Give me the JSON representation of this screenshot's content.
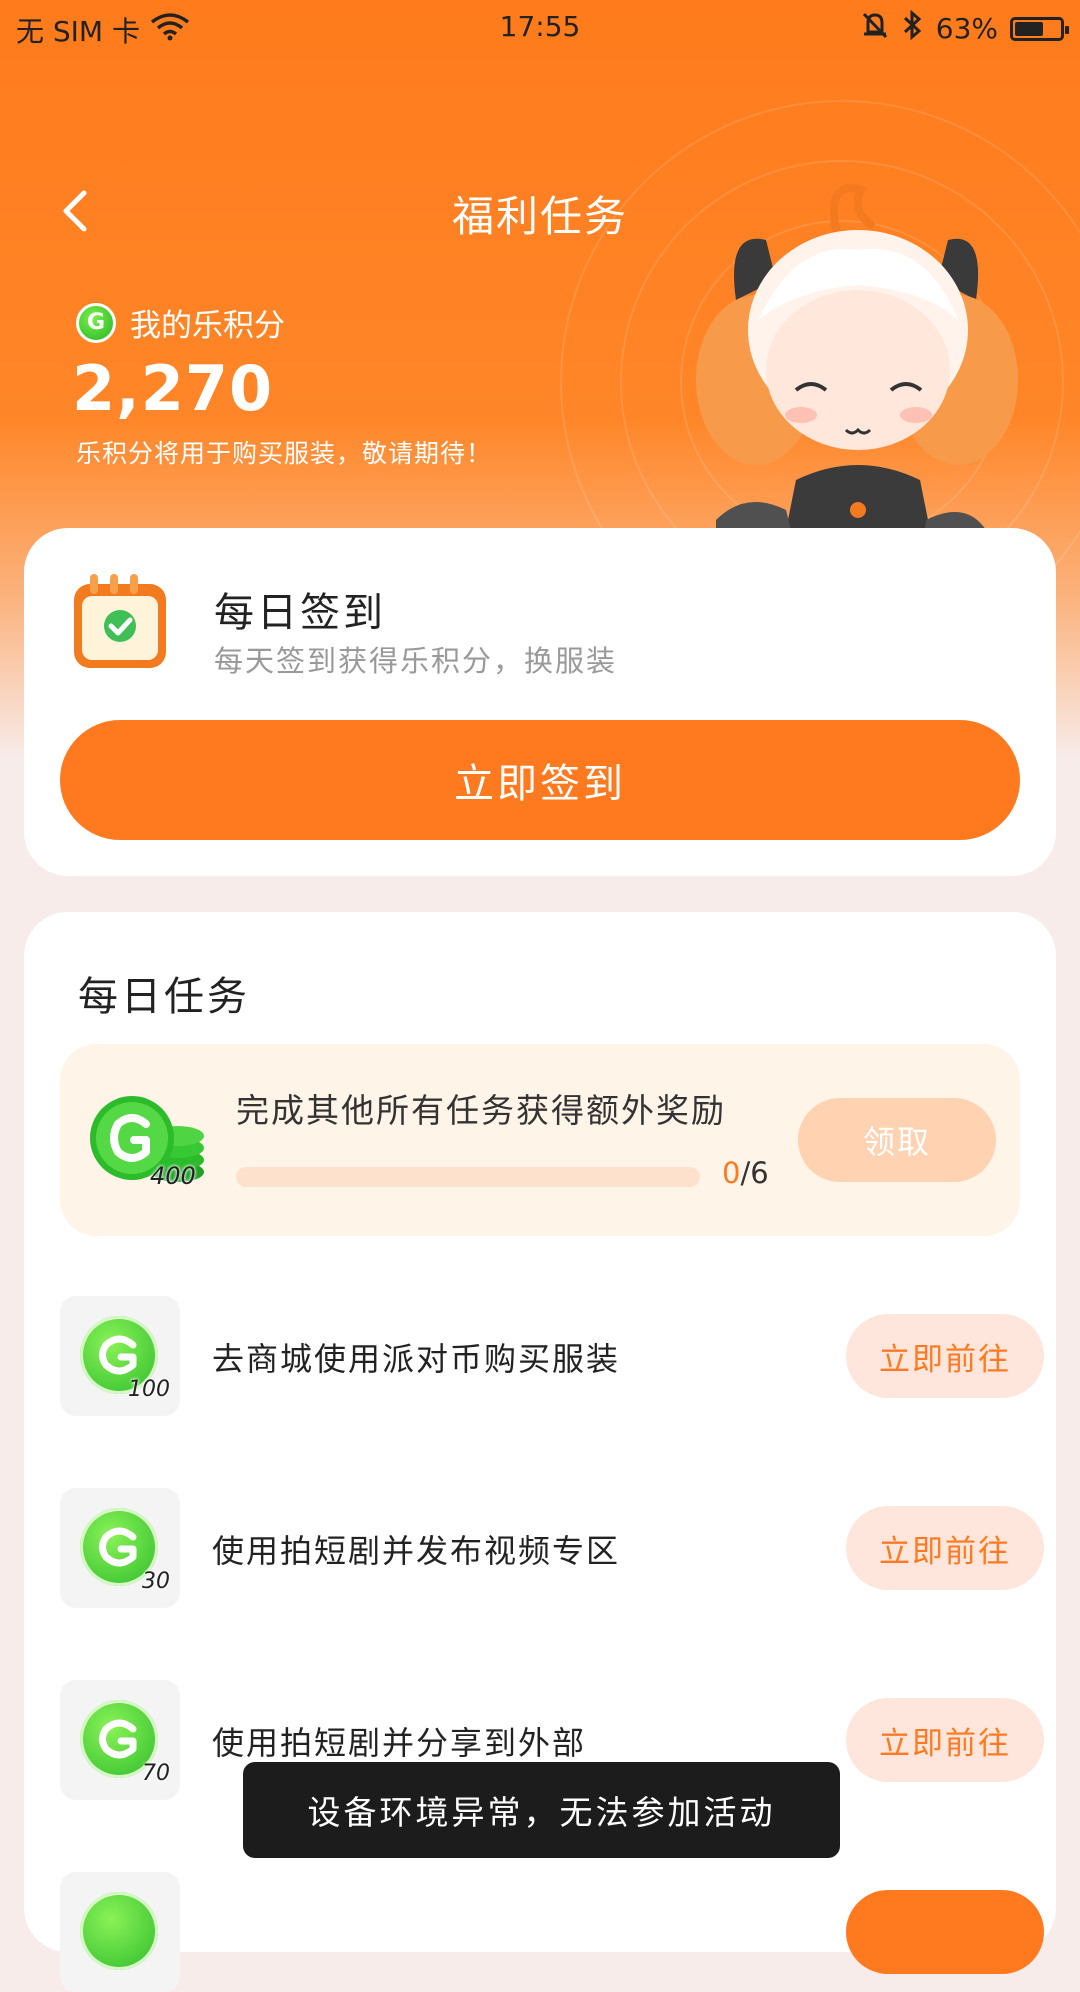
{
  "status_bar": {
    "carrier": "无 SIM 卡",
    "time": "17:55",
    "battery_percent": "63%",
    "battery_level": 0.63
  },
  "header": {
    "title": "福利任务"
  },
  "points": {
    "label": "我的乐积分",
    "value": "2,270",
    "note": "乐积分将用于购买服装，敬请期待！"
  },
  "checkin": {
    "title": "每日签到",
    "subtitle": "每天签到获得乐积分，换服装",
    "button": "立即签到"
  },
  "daily_tasks": {
    "title": "每日任务",
    "bonus": {
      "text": "完成其他所有任务获得额外奖励",
      "reward": "400",
      "done": "0",
      "total": "/6",
      "progress_fraction": 0,
      "button": "领取"
    },
    "items": [
      {
        "reward": "100",
        "label": "去商城使用派对币购买服装",
        "button": "立即前往"
      },
      {
        "reward": "30",
        "label": "使用拍短剧并发布视频专区",
        "button": "立即前往"
      },
      {
        "reward": "70",
        "label": "使用拍短剧并分享到外部",
        "button": "立即前往"
      }
    ]
  },
  "toast": "设备环境异常，无法参加活动",
  "colors": {
    "accent": "#ff7a1f",
    "coin_green": "#2cbb2a"
  }
}
